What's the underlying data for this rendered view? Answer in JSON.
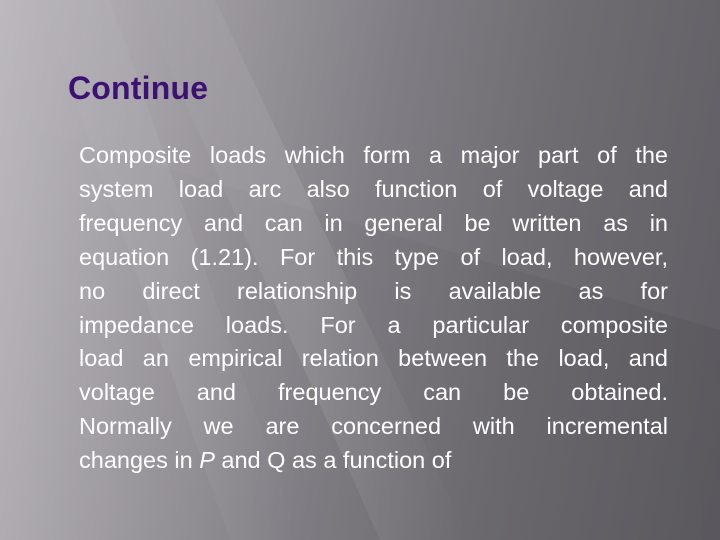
{
  "slide": {
    "title": "Continue",
    "title_color": "#3c1173",
    "text_color": "#ffffff",
    "paragraph_lines": [
      "Composite loads which form a major part of the",
      "system load arc also function of voltage and",
      "frequency and can in general be written as in",
      "equation (1.21). For this type of load, however,",
      "no direct relationship is available as for",
      "impedance loads. For a particular composite",
      "load an empirical relation between the load, and",
      "voltage and frequency can be obtained.",
      "Normally we are concerned with incremental"
    ],
    "last_line": {
      "prefix": "changes in ",
      "italic_var": "P",
      "suffix": " and Q as a function of"
    }
  }
}
